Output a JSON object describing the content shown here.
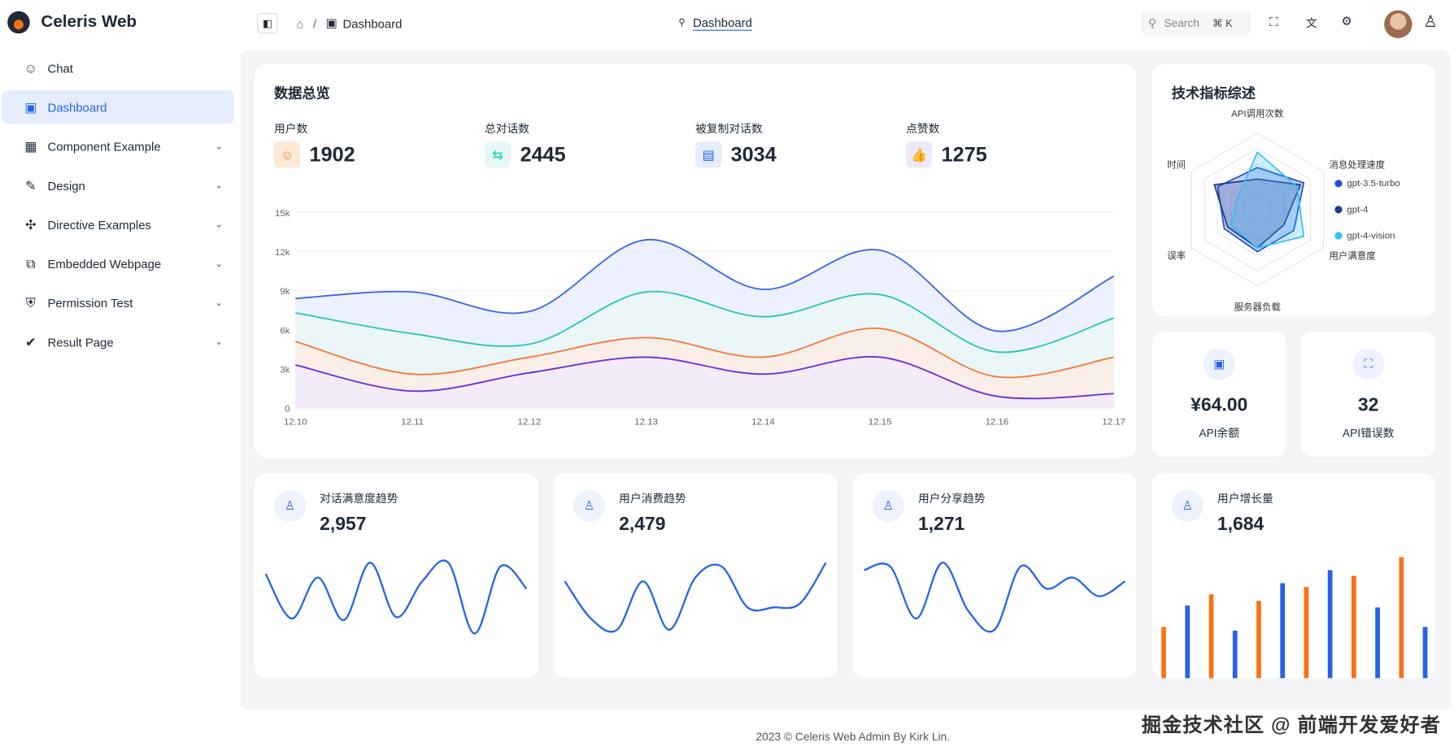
{
  "app": {
    "name": "Celeris Web"
  },
  "sidebar": {
    "items": [
      {
        "label": "Chat",
        "icon": "chat-icon",
        "glyph": "☺"
      },
      {
        "label": "Dashboard",
        "icon": "monitor-icon",
        "glyph": "▣",
        "active": true
      },
      {
        "label": "Component Example",
        "icon": "grid-icon",
        "glyph": "▦",
        "chevron": true
      },
      {
        "label": "Design",
        "icon": "design-tools-icon",
        "glyph": "✎",
        "chevron": true
      },
      {
        "label": "Directive Examples",
        "icon": "puzzle-icon",
        "glyph": "✣",
        "chevron": true
      },
      {
        "label": "Embedded Webpage",
        "icon": "external-link-icon",
        "glyph": "⧉",
        "chevron": true
      },
      {
        "label": "Permission Test",
        "icon": "shield-icon",
        "glyph": "⛨",
        "chevron": true
      },
      {
        "label": "Result Page",
        "icon": "check-circle-icon",
        "glyph": "✔",
        "chevron": true
      }
    ]
  },
  "header": {
    "breadcrumb": "Dashboard",
    "tab": "Dashboard",
    "search_placeholder": "Search",
    "shortcut": "⌘ K",
    "separator": "/"
  },
  "overview": {
    "title": "数据总览",
    "stats": [
      {
        "label": "用户数",
        "value": "1902",
        "icon": "user-icon",
        "glyph": "☺",
        "color": "#f97316",
        "bg": "#fde9d6"
      },
      {
        "label": "总对话数",
        "value": "2445",
        "icon": "chat-bubbles-icon",
        "glyph": "⇆",
        "color": "#2dd4bf",
        "bg": "#e6f8f5"
      },
      {
        "label": "被复制对话数",
        "value": "3034",
        "icon": "message-icon",
        "glyph": "▤",
        "color": "#2563eb",
        "bg": "#e6edfd"
      },
      {
        "label": "点赞数",
        "value": "1275",
        "icon": "thumbs-up-icon",
        "glyph": "👍",
        "color": "#7c3aed",
        "bg": "#efe7fd"
      }
    ]
  },
  "chart_data": [
    {
      "type": "area",
      "categories": [
        "12.10",
        "12.11",
        "12.12",
        "12.13",
        "12.14",
        "12.15",
        "12.16",
        "12.17"
      ],
      "yticks": [
        "0",
        "3k",
        "6k",
        "9k",
        "12k",
        "15k"
      ],
      "ylim": [
        0,
        15000
      ],
      "grid": true,
      "series": [
        {
          "color": "#3b66e6",
          "fill": "#e8edfc",
          "values": [
            8400,
            8900,
            7400,
            12900,
            9100,
            12100,
            5900,
            10100
          ]
        },
        {
          "color": "#2ec4b6",
          "fill": "#e9f8f5",
          "values": [
            7300,
            5700,
            4900,
            8900,
            7000,
            8700,
            4300,
            6900
          ]
        },
        {
          "color": "#f07b3f",
          "fill": "#fdeee4",
          "values": [
            5100,
            2600,
            3900,
            5400,
            3900,
            6100,
            2400,
            3900
          ]
        },
        {
          "color": "#6d2fd6",
          "fill": "#f1ebfb",
          "values": [
            3300,
            1300,
            2700,
            3900,
            2600,
            3900,
            900,
            1100
          ]
        }
      ]
    },
    {
      "type": "radar",
      "title": "技术指标综述",
      "indicators": [
        "API调用次数",
        "消息处理速度",
        "用户满意度",
        "服务器负载",
        "误率",
        "时间"
      ],
      "max": 100,
      "legend_position": "right",
      "series": [
        {
          "name": "gpt-3.5-turbo",
          "color": "#1d4ed8",
          "values": [
            55,
            70,
            55,
            55,
            50,
            60
          ]
        },
        {
          "name": "gpt-4",
          "color": "#1e3a8a",
          "values": [
            40,
            65,
            40,
            50,
            45,
            65
          ]
        },
        {
          "name": "gpt-4-vision",
          "color": "#38bdf8",
          "values": [
            75,
            60,
            70,
            50,
            40,
            30
          ]
        }
      ]
    },
    {
      "type": "line",
      "title": "对话满意度趋势",
      "values": [
        80,
        20,
        75,
        18,
        95,
        22,
        70,
        95,
        0,
        90,
        60
      ]
    },
    {
      "type": "line",
      "title": "用户消费趋势",
      "values": [
        70,
        20,
        5,
        70,
        5,
        75,
        90,
        35,
        35,
        40,
        95
      ]
    },
    {
      "type": "line",
      "title": "用户分享趋势",
      "values": [
        85,
        90,
        20,
        95,
        30,
        5,
        90,
        60,
        75,
        50,
        70
      ]
    },
    {
      "type": "bar",
      "title": "用户增长量",
      "values": [
        55,
        78,
        90,
        51,
        83,
        102,
        98,
        116,
        110,
        76,
        130,
        55
      ],
      "colors": [
        "#f97316",
        "#2563eb"
      ]
    }
  ],
  "small_cards": [
    {
      "value": "¥64.00",
      "label": "API余额",
      "icon": "wallet-icon",
      "glyph": "▣"
    },
    {
      "value": "32",
      "label": "API错误数",
      "icon": "scan-icon",
      "glyph": "⛶"
    }
  ],
  "trend_cards": [
    {
      "title": "对话满意度趋势",
      "value": "2,957",
      "icon": "user-heart-icon"
    },
    {
      "title": "用户消费趋势",
      "value": "2,479",
      "icon": "user-dollar-icon"
    },
    {
      "title": "用户分享趋势",
      "value": "1,271",
      "icon": "user-share-icon"
    },
    {
      "title": "用户增长量",
      "value": "1,684",
      "icon": "user-up-icon"
    }
  ],
  "footer": "2023 © Celeris Web Admin By Kirk Lin.",
  "watermark": "掘金技术社区 @ 前端开发爱好者"
}
